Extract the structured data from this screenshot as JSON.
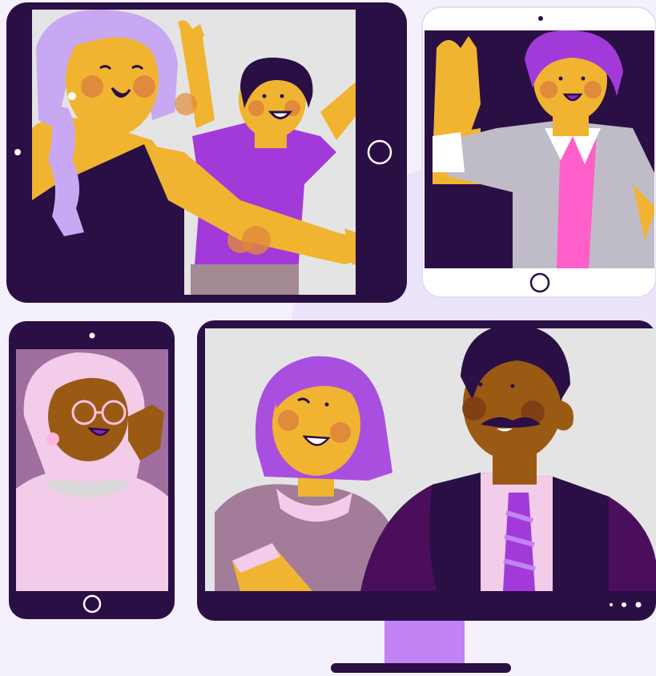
{
  "scene": {
    "label": "",
    "colors": {
      "background": "#f4f0fc",
      "device_frame": "#2a0f45",
      "screen_light": "#e4e4e4",
      "skin_yellow": "#f0b431",
      "skin_brown": "#9a5a14",
      "purple_hair": "#a94fe0",
      "lavender_hair": "#c9a8f3",
      "cheek": "#e08a3c",
      "monitor_stand": "#c283f5",
      "tie_pink": "#ff5fc8"
    },
    "devices": [
      {
        "name": "tablet-landscape",
        "home_button": "circle-icon"
      },
      {
        "name": "tablet-portrait-white",
        "home_button": "circle-icon"
      },
      {
        "name": "phone-portrait",
        "home_button": "circle-icon"
      },
      {
        "name": "desktop-monitor",
        "indicator": "three-dots-icon"
      }
    ]
  }
}
